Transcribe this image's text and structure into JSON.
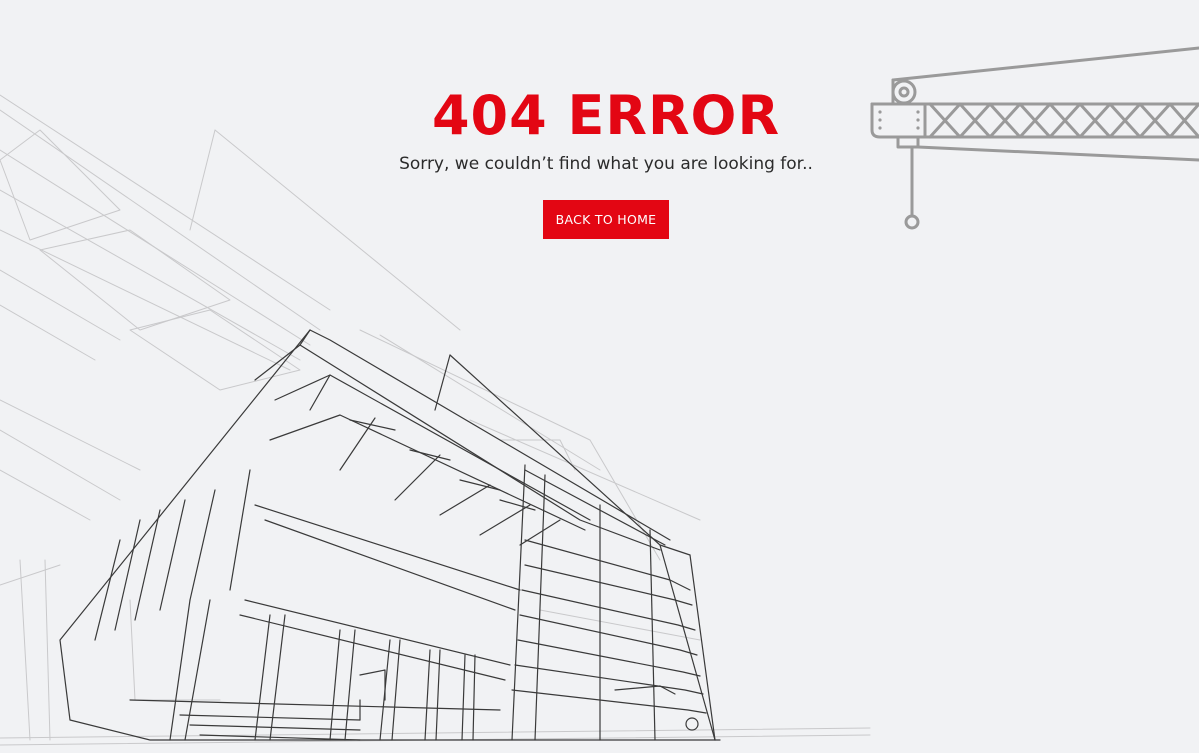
{
  "error": {
    "title": "404 ERROR",
    "message": "Sorry, we couldn’t find what you are looking for..",
    "back_button_label": "BACK TO HOME"
  },
  "colors": {
    "accent": "#e30613",
    "background": "#f1f2f4",
    "text": "#2b2b2b",
    "line_art_dark": "#3a3a3a",
    "line_art_light": "#c6c6c8",
    "crane": "#9a9a9a"
  },
  "icons": [
    "building-sketch-illustration",
    "crane-illustration"
  ]
}
